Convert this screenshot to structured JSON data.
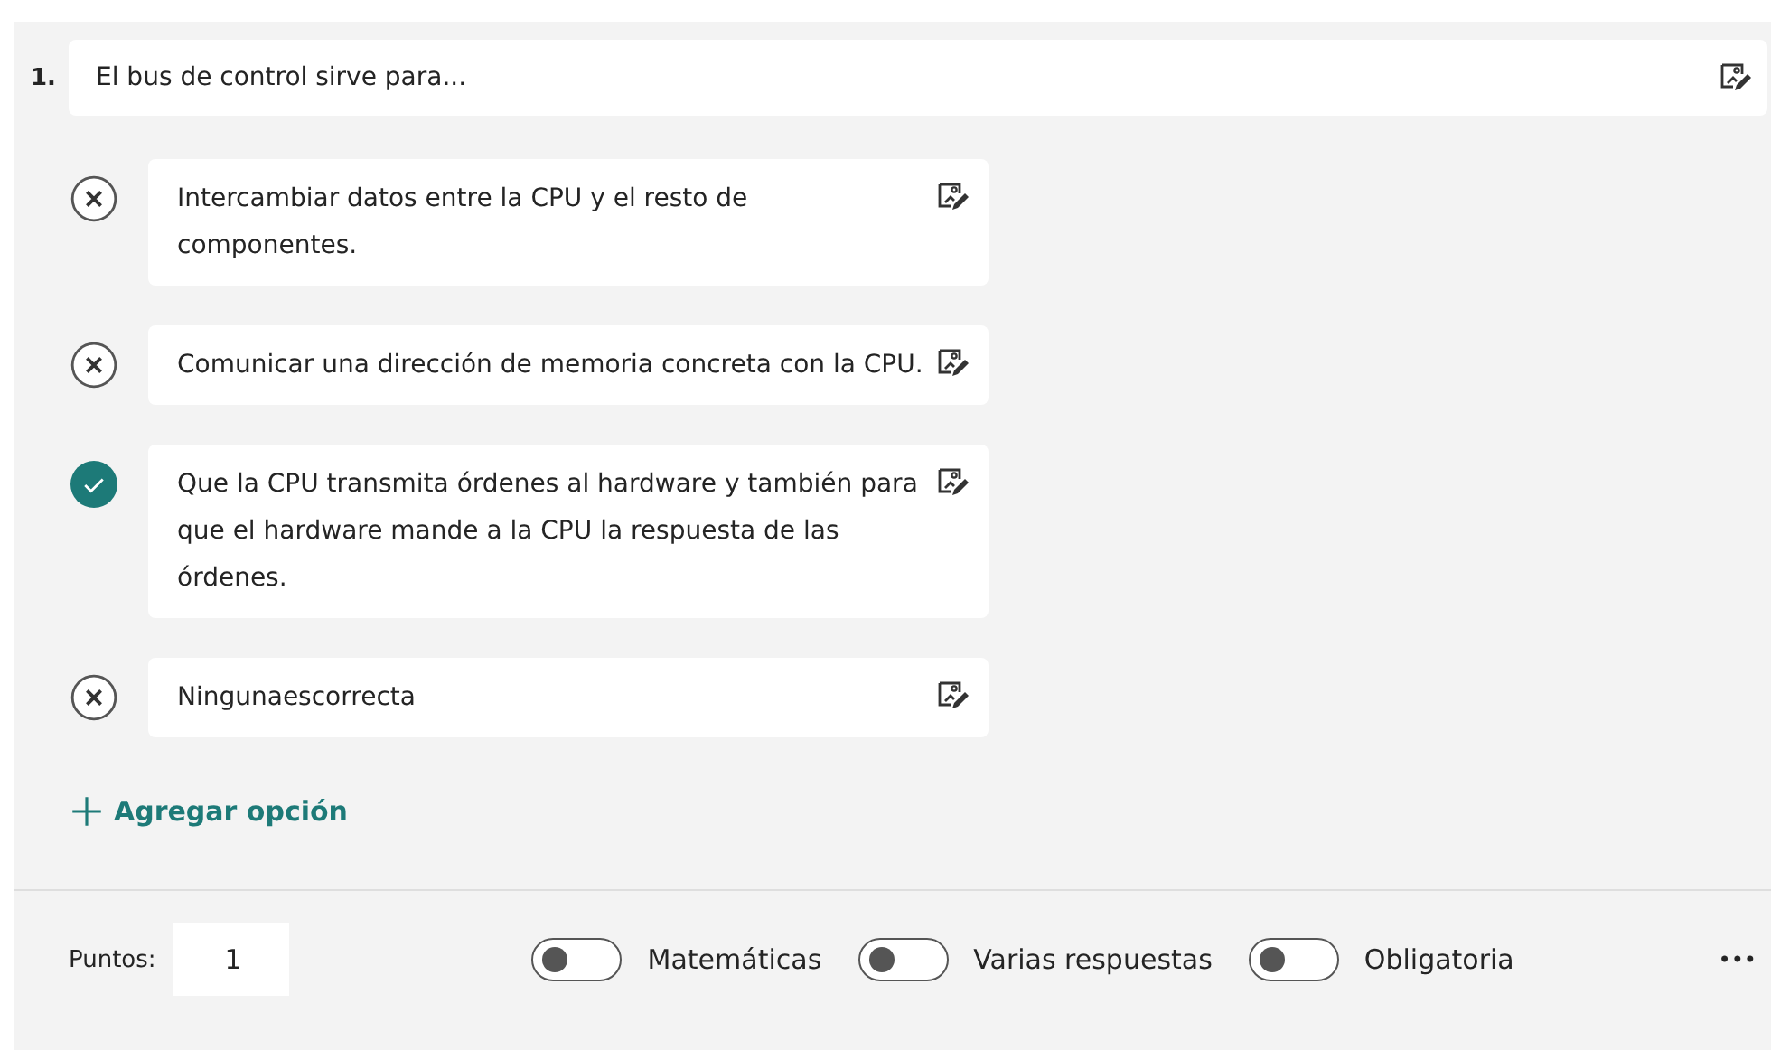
{
  "question": {
    "number": "1.",
    "text": "El bus de control sirve para..."
  },
  "options": [
    {
      "text": "Intercambiar datos entre la CPU y el resto de componentes.",
      "correct": false
    },
    {
      "text": "Comunicar una dirección de memoria concreta con la CPU.",
      "correct": false
    },
    {
      "text": "Que la CPU transmita órdenes al hardware y también para que el hardware mande a la CPU la respuesta de las órdenes.",
      "correct": true
    },
    {
      "text": "Ningunaescorrecta",
      "correct": false
    }
  ],
  "add_option": "Agregar opción",
  "footer": {
    "points_label": "Puntos:",
    "points_value": "1",
    "toggles": [
      {
        "label": "Matemáticas",
        "on": false
      },
      {
        "label": "Varias respuestas",
        "on": false
      },
      {
        "label": "Obligatoria",
        "on": false
      }
    ],
    "more": "•••"
  }
}
